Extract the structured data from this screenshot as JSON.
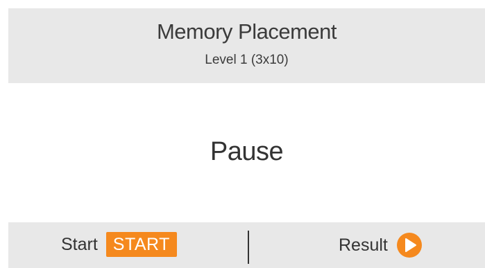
{
  "header": {
    "title": "Memory Placement",
    "subtitle": "Level 1 (3x10)"
  },
  "main": {
    "status_text": "Pause"
  },
  "footer": {
    "start_label": "Start",
    "start_button_label": "START",
    "result_label": "Result",
    "result_icon": "play-circle-icon"
  },
  "colors": {
    "accent": "#f5891e",
    "bar_background": "#e8e8e8",
    "text": "#333333"
  }
}
